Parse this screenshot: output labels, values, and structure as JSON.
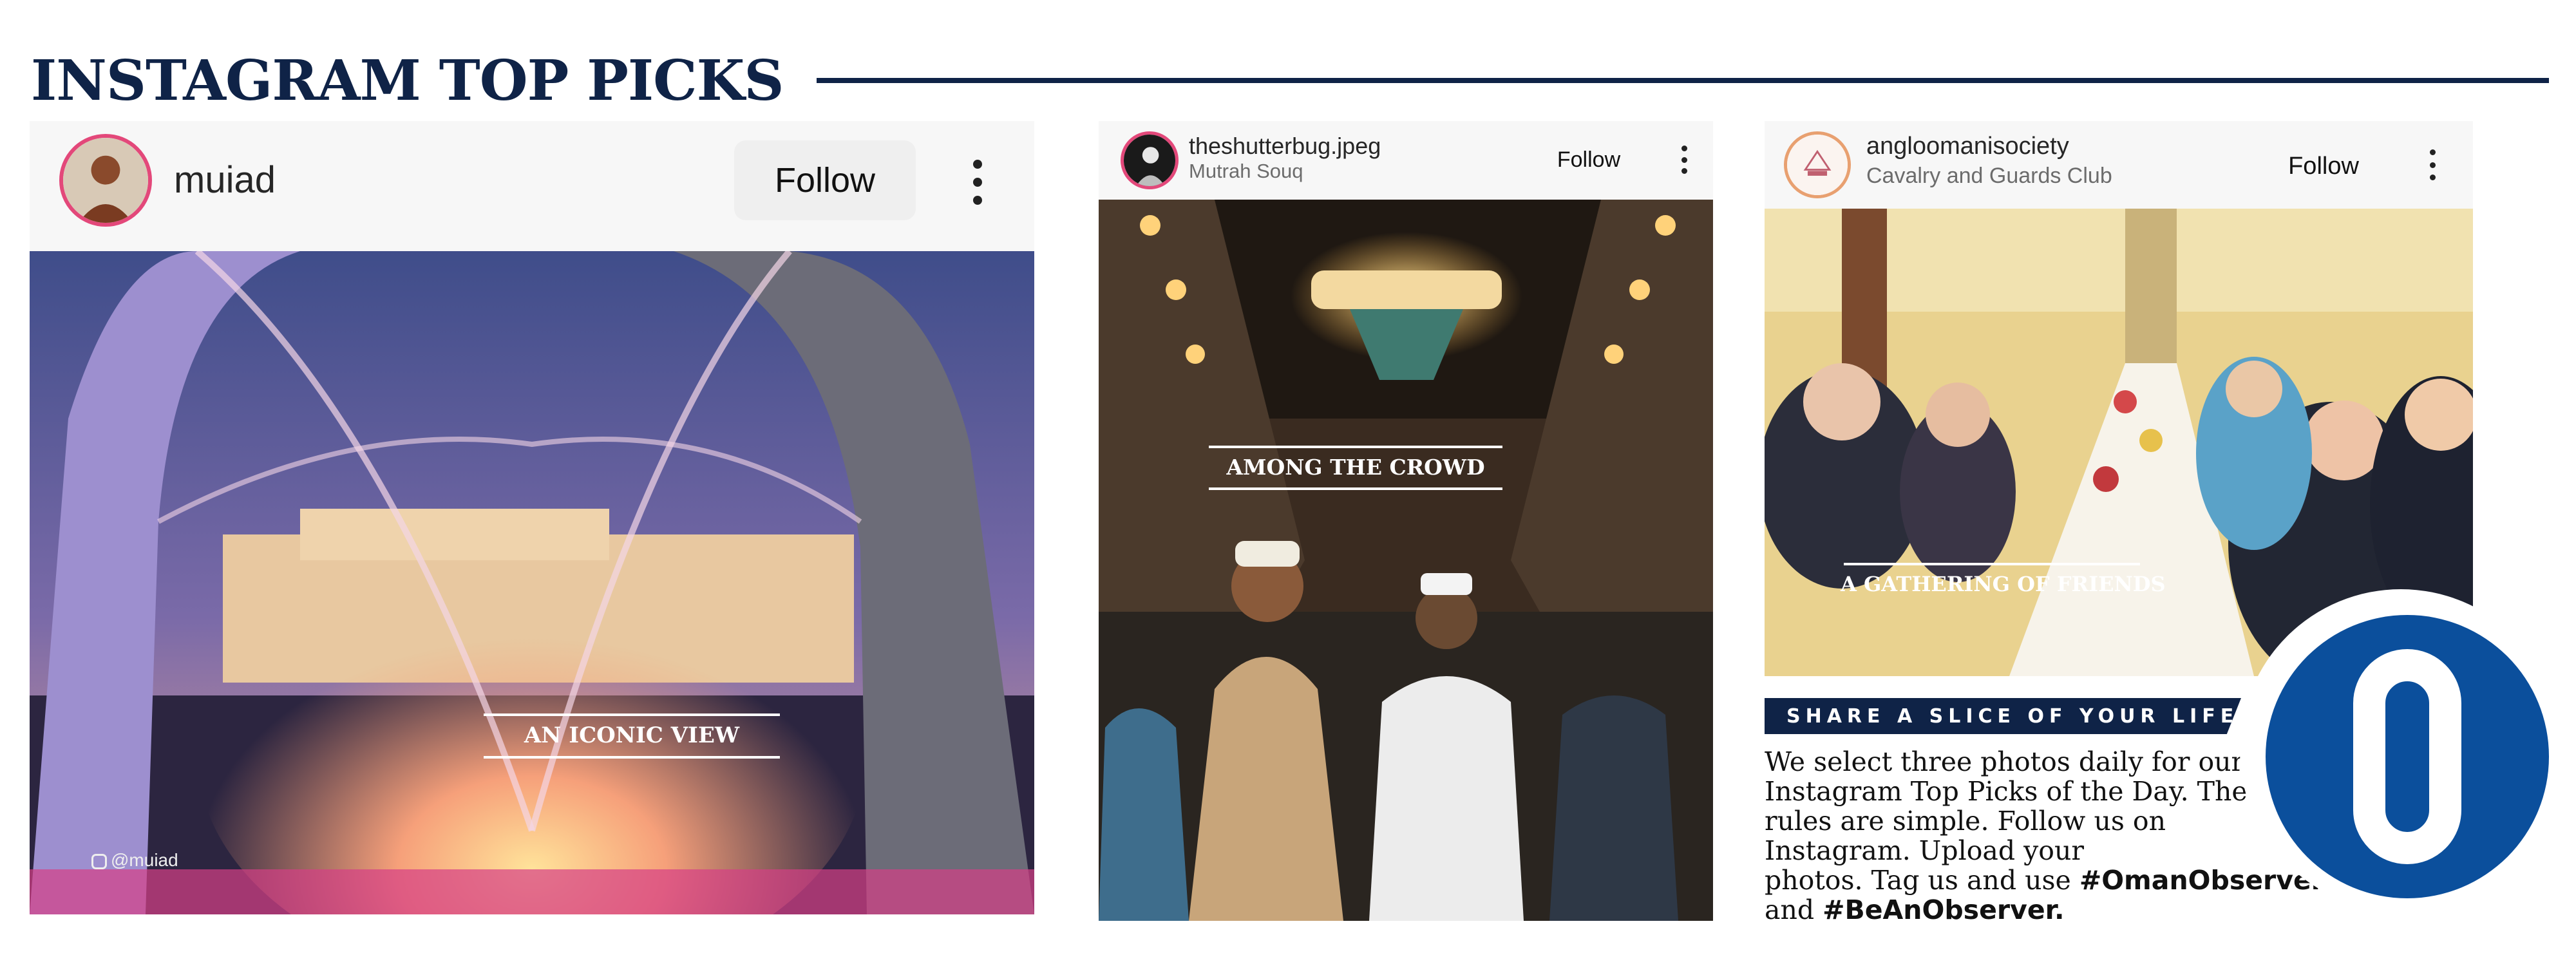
{
  "page": {
    "title": "INSTAGRAM TOP PICKS"
  },
  "posts": [
    {
      "username": "muiad",
      "location": "",
      "follow_label": "Follow",
      "caption": "AN ICONIC VIEW",
      "watermark": "@muiad"
    },
    {
      "username": "theshutterbug.jpeg",
      "location": "Mutrah Souq",
      "follow_label": "Follow",
      "caption": "AMONG THE CROWD"
    },
    {
      "username": "angloomanisociety",
      "location": "Cavalry and Guards Club",
      "follow_label": "Follow",
      "caption": "A GATHERING OF FRIENDS"
    }
  ],
  "promo": {
    "banner": "SHARE A SLICE OF YOUR LIFE",
    "lines": [
      "We select three photos daily for our",
      "Instagram Top Picks of the Day. The",
      "rules are simple. Follow us on",
      "Instagram. Upload your"
    ],
    "line5_text": "photos. Tag us and use ",
    "hashtag1": "#OmanObserver",
    "line6_text": "and ",
    "hashtag2": "#BeAnObserver."
  },
  "colors": {
    "navy": "#0f2347",
    "logo_blue": "#0b4f9c"
  },
  "icons": {
    "more": "vertical-ellipsis-icon",
    "logo": "observer-o-logo"
  }
}
